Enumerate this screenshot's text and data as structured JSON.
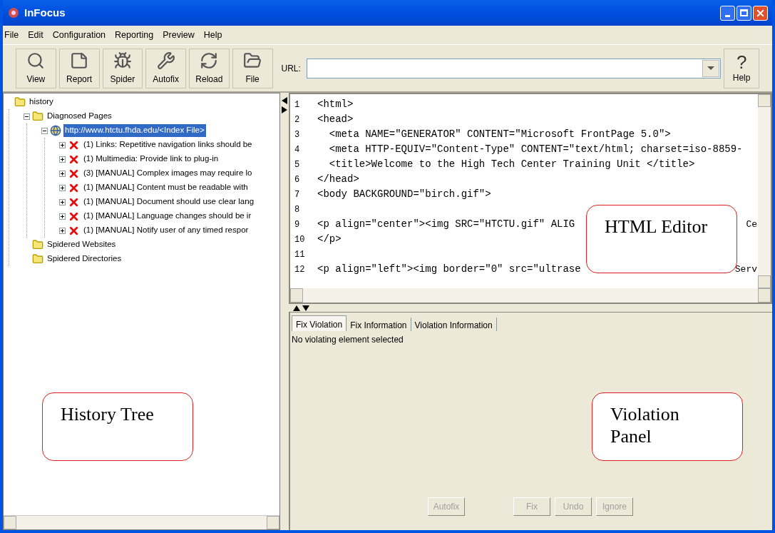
{
  "window": {
    "title": "InFocus"
  },
  "menu": [
    {
      "label": "File"
    },
    {
      "label": "Edit"
    },
    {
      "label": "Configuration"
    },
    {
      "label": "Reporting"
    },
    {
      "label": "Preview"
    },
    {
      "label": "Help"
    }
  ],
  "toolbar": [
    {
      "label": "View",
      "kind": "view"
    },
    {
      "label": "Report",
      "kind": "report"
    },
    {
      "label": "Spider",
      "kind": "spider"
    },
    {
      "label": "Autofix",
      "kind": "autofix"
    },
    {
      "label": "Reload",
      "kind": "reload"
    },
    {
      "label": "File",
      "kind": "file"
    }
  ],
  "url": {
    "label": "URL:"
  },
  "help_button": {
    "glyph": "?",
    "label": "Help"
  },
  "tree": [
    {
      "label": "history",
      "kind": "folder",
      "selected": false,
      "children": [
        {
          "label": "Diagnosed Pages",
          "kind": "folder",
          "expanded": true,
          "selected": false,
          "children": [
            {
              "label": "http://www.htctu.fhda.edu/<Index File>",
              "kind": "page",
              "expanded": true,
              "selected": true,
              "children": [
                {
                  "label": "(1) Links: Repetitive navigation links should be",
                  "kind": "violation",
                  "expanded": false,
                  "selected": false
                },
                {
                  "label": "(1) Multimedia: Provide link to plug-in",
                  "kind": "violation",
                  "expanded": false,
                  "selected": false
                },
                {
                  "label": "(3) [MANUAL] Complex images may require lo",
                  "kind": "violation",
                  "expanded": false,
                  "selected": false
                },
                {
                  "label": "(1) [MANUAL] Content must be readable with",
                  "kind": "violation",
                  "expanded": false,
                  "selected": false
                },
                {
                  "label": "(1) [MANUAL] Document should use clear lang",
                  "kind": "violation",
                  "expanded": false,
                  "selected": false
                },
                {
                  "label": "(1) [MANUAL] Language changes should be ir",
                  "kind": "violation",
                  "expanded": false,
                  "selected": false
                },
                {
                  "label": "(1) [MANUAL] Notify user of any timed respor",
                  "kind": "violation",
                  "expanded": false,
                  "selected": false
                }
              ]
            }
          ]
        },
        {
          "label": "Spidered Websites",
          "kind": "folder",
          "selected": false
        },
        {
          "label": "Spidered Directories",
          "kind": "folder",
          "selected": false
        }
      ]
    }
  ],
  "editor": {
    "lines": [
      {
        "num": "1",
        "text": "<html>"
      },
      {
        "num": "2",
        "text": "<head>"
      },
      {
        "num": "3",
        "text": "  <meta NAME=\"GENERATOR\" CONTENT=\"Microsoft FrontPage 5.0\">"
      },
      {
        "num": "4",
        "text": "  <meta HTTP-EQUIV=\"Content-Type\" CONTENT=\"text/html; charset=iso-8859-"
      },
      {
        "num": "5",
        "text": "  <title>Welcome to the High Tech Center Training Unit </title>"
      },
      {
        "num": "6",
        "text": "</head>"
      },
      {
        "num": "7",
        "text": "<body BACKGROUND=\"birch.gif\">"
      },
      {
        "num": "8"
      },
      {
        "num": "9",
        "text": "<p align=\"center\"><img SRC=\"HTCTU.gif\" ALIG",
        "tail": "Ce"
      },
      {
        "num": "10",
        "text": "</p>"
      },
      {
        "num": "11"
      },
      {
        "num": "12",
        "text": "<p align=\"left\"><img border=\"0\" src=\"ultrase",
        "tail": "Serv"
      }
    ]
  },
  "tabs": [
    {
      "label": "Fix Violation",
      "selected": true
    },
    {
      "label": "Fix Information",
      "selected": false
    },
    {
      "label": "Violation Information",
      "selected": false
    }
  ],
  "status": "No violating element selected",
  "buttons": [
    {
      "label": "Autofix",
      "disabled": true
    },
    {
      "label": "Fix",
      "disabled": true
    },
    {
      "label": "Undo",
      "disabled": true
    },
    {
      "label": "Ignore",
      "disabled": true
    }
  ],
  "callouts": [
    {
      "text": "HTML Editor",
      "kind": "editor"
    },
    {
      "text": "History Tree",
      "kind": "tree"
    },
    {
      "text": "Violation Panel",
      "kind": "panel"
    }
  ]
}
